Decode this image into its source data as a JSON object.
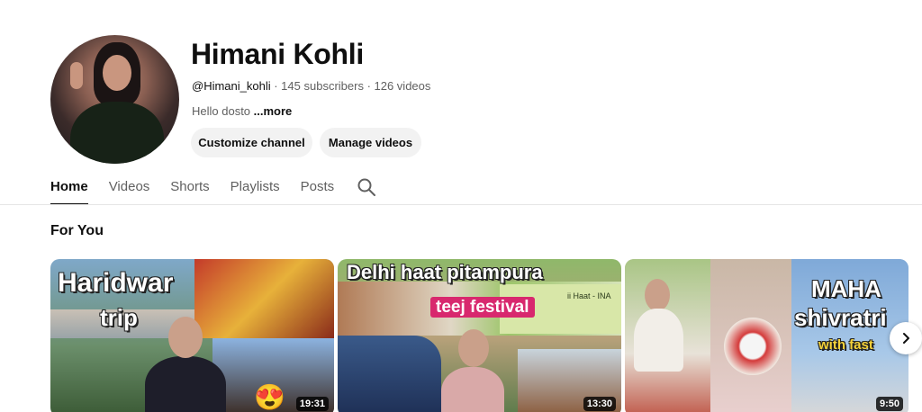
{
  "channel": {
    "name": "Himani Kohli",
    "handle": "@Himani_kohli",
    "subscribers": " · 145 subscribers",
    "videos": " · 126 videos",
    "description": "Hello dosto ",
    "more_label": "...more"
  },
  "actions": {
    "customize_label": "Customize channel",
    "manage_label": "Manage videos"
  },
  "tabs": [
    {
      "label": "Home",
      "active": true
    },
    {
      "label": "Videos"
    },
    {
      "label": "Shorts"
    },
    {
      "label": "Playlists"
    },
    {
      "label": "Posts"
    }
  ],
  "section": {
    "title": "For You"
  },
  "videos": [
    {
      "overlay_lines": [
        "Haridwar",
        "trip"
      ],
      "duration": "19:31",
      "sticker": "😍"
    },
    {
      "overlay_lines": [
        "Delhi haat pitampura",
        "teej festival"
      ],
      "banner_text": "ii Haat - INA",
      "duration": "13:30"
    },
    {
      "overlay_lines": [
        "MAHA",
        "shivratri",
        "with fast"
      ],
      "duration": "9:50"
    }
  ],
  "icons": {
    "search": "search-icon",
    "next": "chevron-right-icon"
  },
  "colors": {
    "button_bg": "#f2f2f2",
    "text_primary": "#0f0f0f",
    "text_secondary": "#606060"
  }
}
